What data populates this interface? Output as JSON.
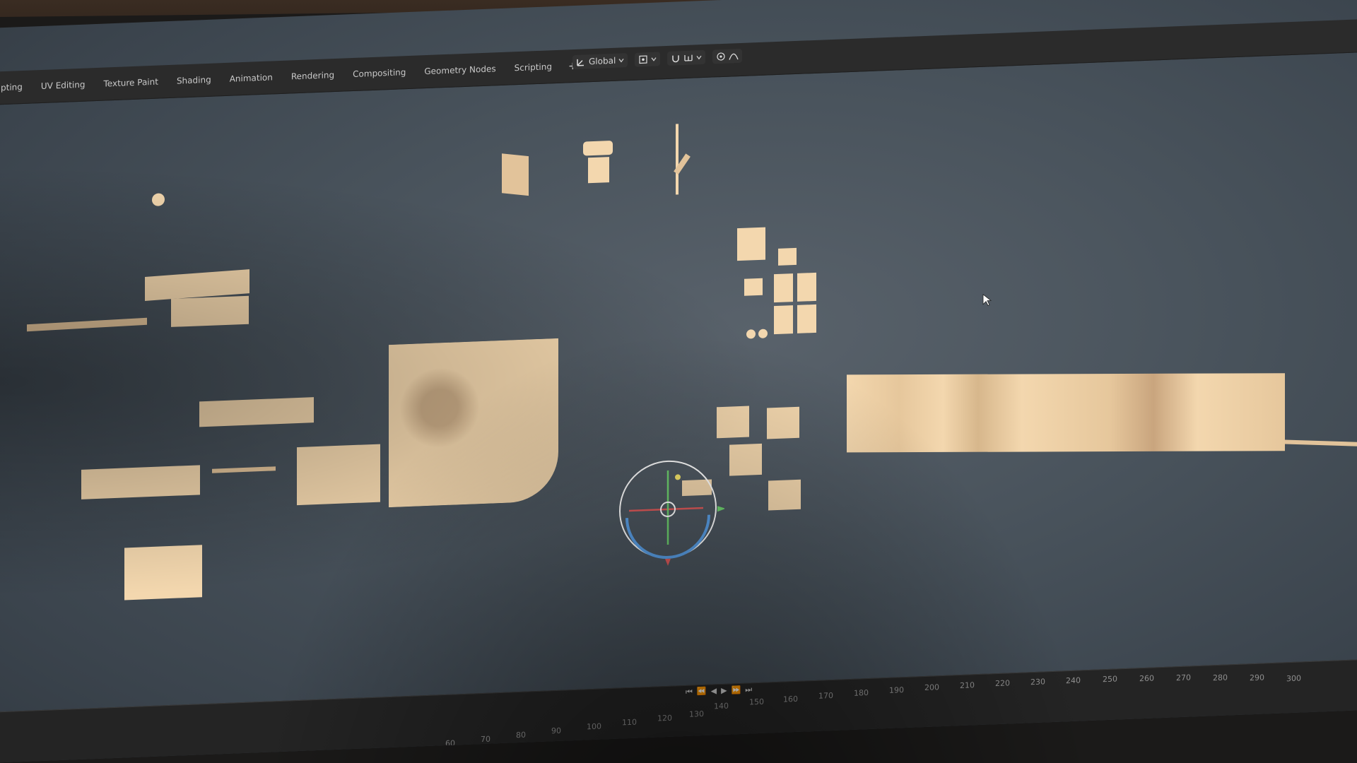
{
  "workspace_tabs": [
    {
      "label": "pting"
    },
    {
      "label": "UV Editing"
    },
    {
      "label": "Texture Paint"
    },
    {
      "label": "Shading"
    },
    {
      "label": "Animation"
    },
    {
      "label": "Rendering"
    },
    {
      "label": "Compositing"
    },
    {
      "label": "Geometry Nodes"
    },
    {
      "label": "Scripting"
    }
  ],
  "add_tab_label": "+",
  "toolbar": {
    "orientation_label": "Global",
    "orientation_icon": "transform-orientation-icon",
    "pivot_icon": "pivot-point-icon",
    "snap_icon": "snap-icon",
    "proportional_icon": "proportional-edit-icon"
  },
  "timeline": {
    "upper_frames": [
      "140",
      "150",
      "160",
      "170",
      "180",
      "190",
      "200",
      "210",
      "220",
      "230",
      "240",
      "250",
      "260",
      "270",
      "280",
      "290",
      "300"
    ],
    "lower_frames": [
      "60",
      "70",
      "80",
      "90",
      "100",
      "110",
      "120",
      "130"
    ]
  },
  "colors": {
    "object_fill": "#f3d7ae",
    "viewport_bg": "#4d5660",
    "gizmo_red": "#e05a5a",
    "gizmo_green": "#6fd36f",
    "gizmo_blue": "#5aa0e8",
    "gizmo_ring": "#ffffff"
  }
}
